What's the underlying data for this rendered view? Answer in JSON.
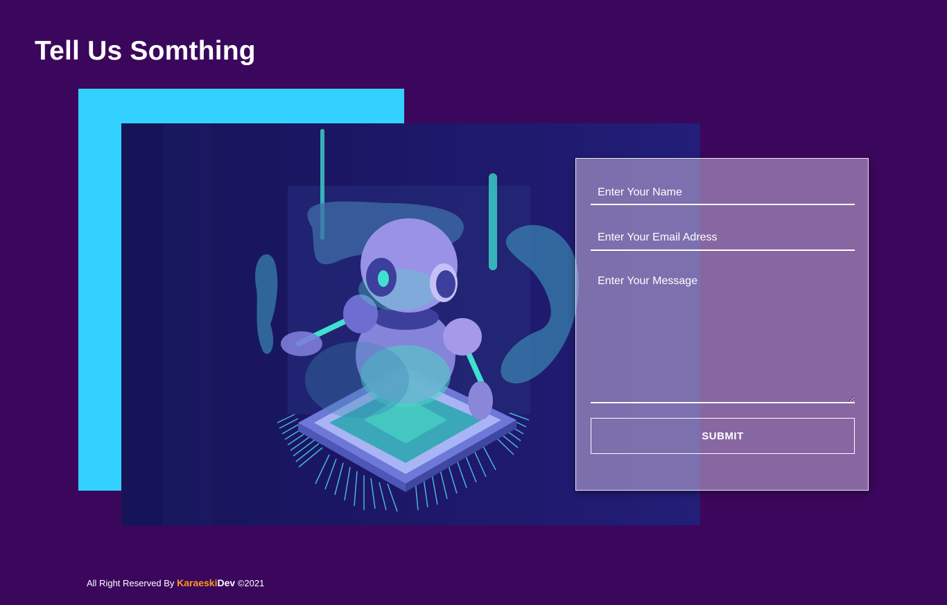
{
  "header": {
    "title": "Tell Us Somthing"
  },
  "form": {
    "name_placeholder": "Enter Your Name",
    "email_placeholder": "Enter Your Email Adress",
    "message_placeholder": "Enter Your Message",
    "submit_label": "SUBMIT"
  },
  "footer": {
    "prefix": "All Right Reserved By",
    "brand_first": "Karaeski",
    "brand_second": "Dev",
    "suffix": "©2021"
  },
  "colors": {
    "background": "#3b075c",
    "accent_block": "#33d1ff",
    "brand_orange": "#ff9a1f"
  },
  "illustration": {
    "subject": "robot-on-chip"
  }
}
